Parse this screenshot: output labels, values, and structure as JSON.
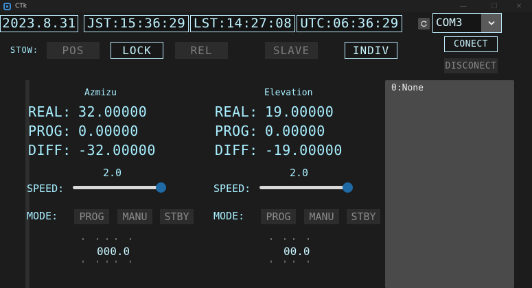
{
  "window": {
    "title": "CTk",
    "minimize": "—",
    "maximize": "☐",
    "close": "✕"
  },
  "clocks": {
    "date": "2023.8.31",
    "jst": "JST:15:36:29",
    "lst": "LST:14:27:08",
    "utc": "UTC:06:36:29"
  },
  "port": {
    "selected": "COM3",
    "connect": "CONECT",
    "disconnect": "DISCONECT"
  },
  "stow": {
    "label": "STOW:",
    "pos": "POS",
    "lock": "LOCK",
    "rel": "REL",
    "slave": "SLAVE",
    "indiv": "INDIV"
  },
  "azimuth": {
    "title": "Azmizu",
    "real_label": "REAL:",
    "real": "32.00000",
    "prog_label": "PROG:",
    "prog": "0.00000",
    "diff_label": "DIFF:",
    "diff": "-32.00000",
    "speed_label": "SPEED:",
    "speed": "2.0",
    "speed_fraction": 1.0,
    "mode_label": "MODE:",
    "modes": [
      "PROG",
      "MANU",
      "STBY"
    ],
    "step_plus": "+",
    "step_minus": "-",
    "step_value": "000.0"
  },
  "elevation": {
    "title": "Elevation",
    "real_label": "REAL:",
    "real": "19.00000",
    "prog_label": "PROG:",
    "prog": "0.00000",
    "diff_label": "DIFF:",
    "diff": "-19.00000",
    "speed_label": "SPEED:",
    "speed": "2.0",
    "speed_fraction": 1.0,
    "mode_label": "MODE:",
    "modes": [
      "PROG",
      "MANU",
      "STBY"
    ],
    "step_plus": "+",
    "step_minus": "-",
    "step_value": "00.0"
  },
  "log": {
    "lines": [
      "0:None"
    ]
  },
  "colors": {
    "accent": "#bfeeff",
    "text": "#a8efff",
    "slider_knob": "#1f6aa5",
    "background": "#1c1c1c"
  }
}
